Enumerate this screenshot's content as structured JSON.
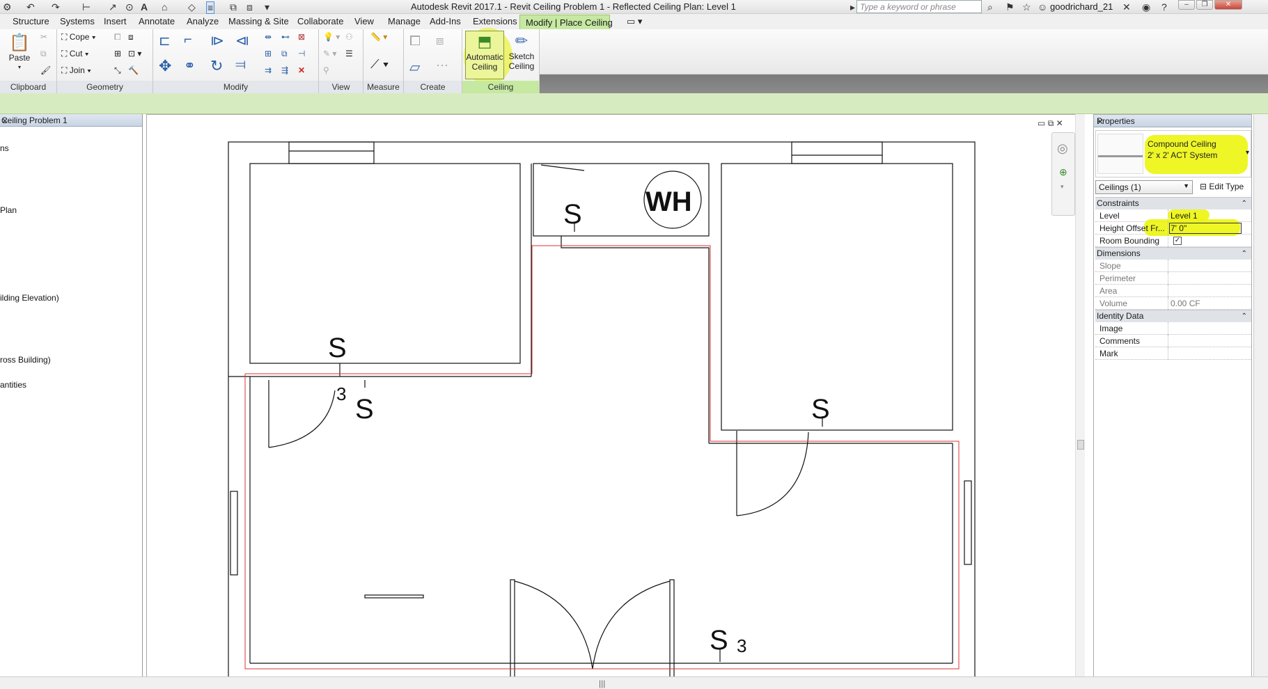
{
  "window": {
    "title": "Autodesk Revit 2017.1 -    Revit Ceiling Problem 1 - Reflected Ceiling Plan: Level 1",
    "search_placeholder": "Type a keyword or phrase",
    "user": "goodrichard_21"
  },
  "menu": {
    "tabs": [
      "Structure",
      "Systems",
      "Insert",
      "Annotate",
      "Analyze",
      "Massing & Site",
      "Collaborate",
      "View",
      "Manage",
      "Add-Ins",
      "Extensions"
    ],
    "active_tab": "Modify | Place Ceiling"
  },
  "ribbon": {
    "clipboard": {
      "title": "Clipboard",
      "paste": "Paste"
    },
    "geometry": {
      "title": "Geometry",
      "cope": "Cope",
      "cut": "Cut",
      "join": "Join"
    },
    "modify": {
      "title": "Modify"
    },
    "view": {
      "title": "View"
    },
    "measure": {
      "title": "Measure"
    },
    "create": {
      "title": "Create"
    },
    "ceiling": {
      "title": "Ceiling",
      "automatic_line1": "Automatic",
      "automatic_line2": "Ceiling",
      "sketch_line1": "Sketch",
      "sketch_line2": "Ceiling"
    }
  },
  "project_browser": {
    "title": "Ceiling Problem 1",
    "items": [
      "ns",
      "Plan",
      "ilding Elevation)",
      "ross Building)",
      "antities"
    ]
  },
  "drawing": {
    "water_heater_label": "WH",
    "switch_tag_1": "3",
    "switch_tag_2": "3",
    "switch_symbol": "S"
  },
  "properties": {
    "title": "Properties",
    "type_family": "Compound Ceiling",
    "type_name": "2' x 2' ACT System",
    "instance_filter": "Ceilings (1)",
    "edit_type": "Edit Type",
    "groups": {
      "constraints": "Constraints",
      "dimensions": "Dimensions",
      "identity": "Identity Data"
    },
    "rows": {
      "level_name": "Level",
      "level_value": "Level 1",
      "height_offset_name": "Height Offset Fr...",
      "height_offset_value": "7'  0\"",
      "room_bounding_name": "Room Bounding",
      "room_bounding_value": "✓",
      "slope_name": "Slope",
      "perimeter_name": "Perimeter",
      "area_name": "Area",
      "volume_name": "Volume",
      "volume_value": "0.00 CF",
      "image_name": "Image",
      "comments_name": "Comments",
      "mark_name": "Mark"
    }
  },
  "colors": {
    "context_tab": "#c6e9a2",
    "highlight": "#ebf500",
    "ceiling_boundary": "#e03030"
  }
}
